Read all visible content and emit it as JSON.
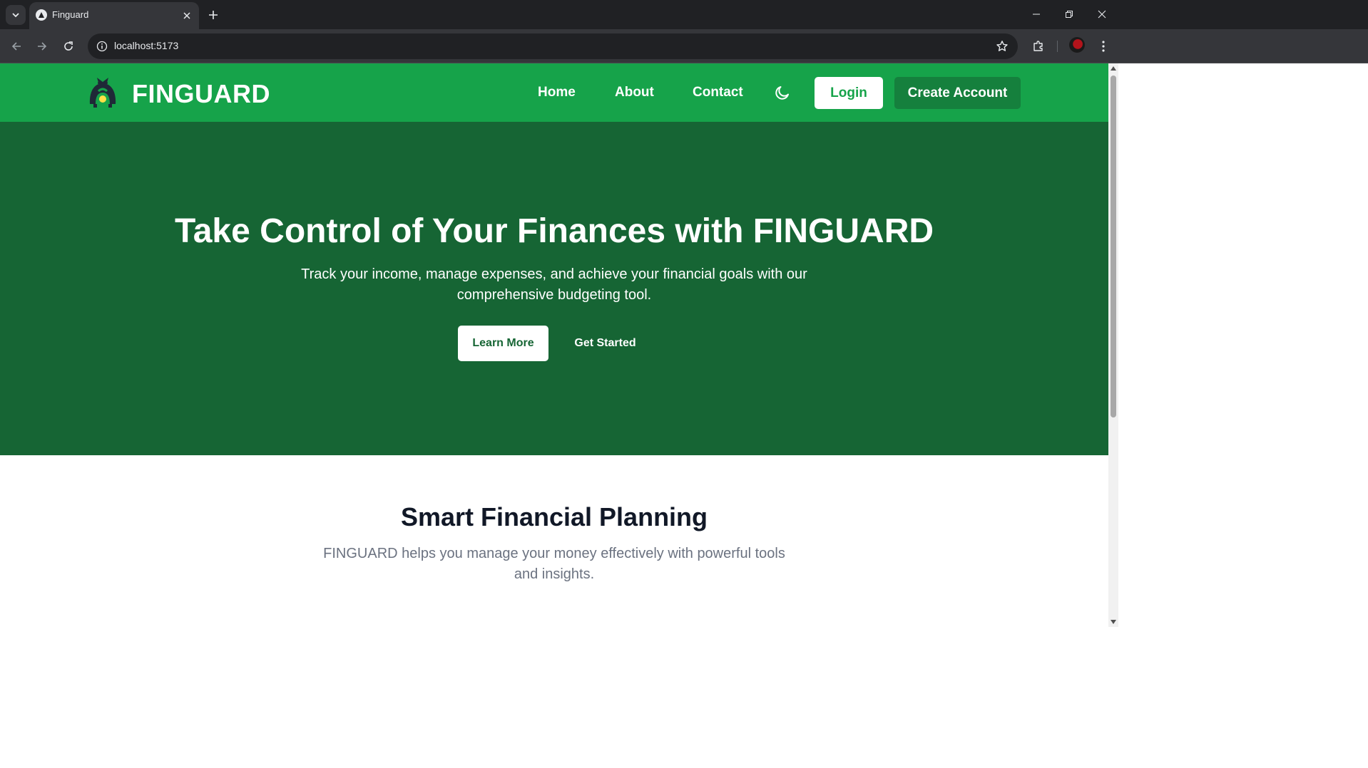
{
  "browser": {
    "tab_title": "Finguard",
    "url": "localhost:5173",
    "icons": [
      "tab-search-icon",
      "close-icon",
      "plus-icon",
      "minimize-icon",
      "restore-icon",
      "window-close-icon",
      "back-arrow-icon",
      "forward-arrow-icon",
      "reload-icon",
      "site-info-icon",
      "bookmark-star-icon",
      "extensions-puzzle-icon",
      "kebab-menu-icon"
    ]
  },
  "nav": {
    "brand": "FINGUARD",
    "links": [
      "Home",
      "About",
      "Contact"
    ],
    "theme_icon": "moon-icon",
    "login_label": "Login",
    "create_account_label": "Create Account"
  },
  "hero": {
    "title": "Take Control of Your Finances with FINGUARD",
    "subtitle": "Track your income, manage expenses, and achieve your financial goals with our comprehensive budgeting tool.",
    "learn_more_label": "Learn More",
    "get_started_label": "Get Started"
  },
  "features": {
    "title": "Smart Financial Planning",
    "subtitle": "FINGUARD helps you manage your money effectively with powerful tools and insights."
  },
  "colors": {
    "nav_bg": "#16a34a",
    "hero_bg": "#166534",
    "create_button_bg": "#15803d",
    "heading_text": "#111827",
    "muted_text": "#6b7280"
  }
}
